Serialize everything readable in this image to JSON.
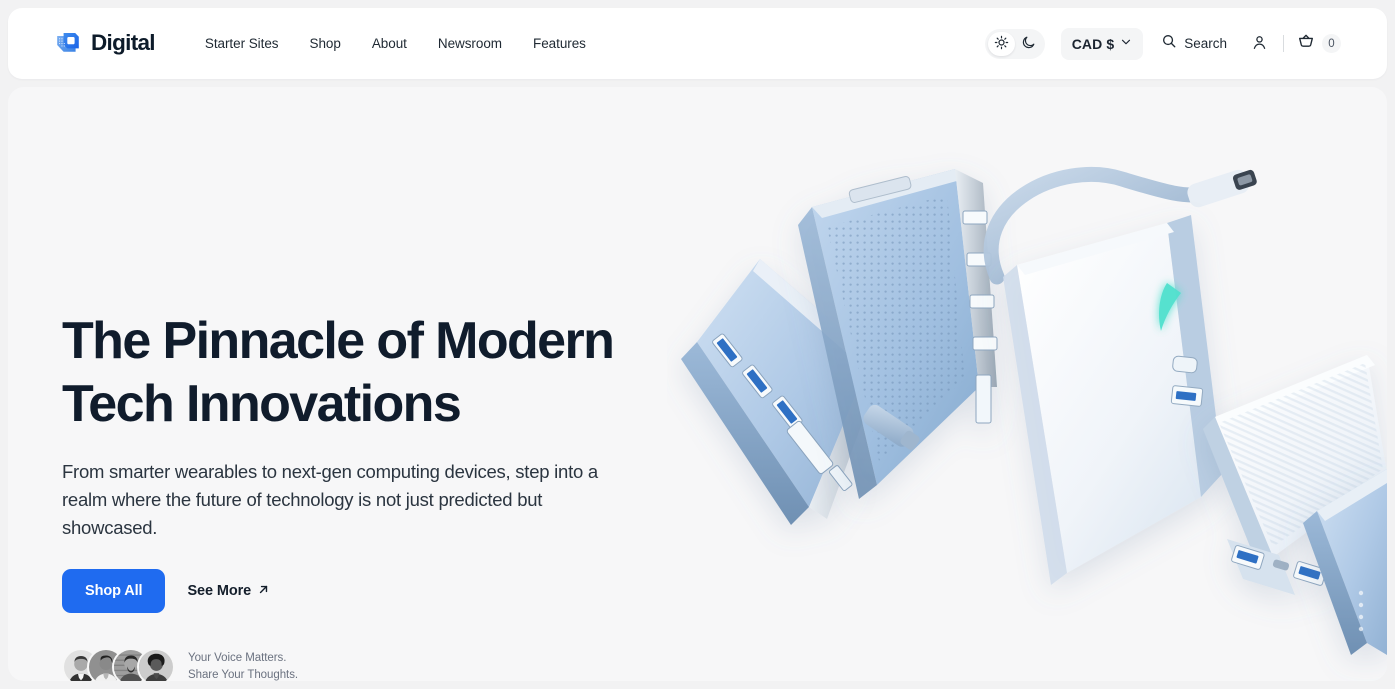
{
  "brand": {
    "name": "Digital",
    "mark_icon": "digital-logo-mark",
    "accent_color": "#1f6bf0",
    "mark_colors": [
      "#4a90e2",
      "#7fb3ef",
      "#1a63e8",
      "#cfe0f7"
    ]
  },
  "nav": {
    "items": [
      {
        "label": "Starter Sites"
      },
      {
        "label": "Shop"
      },
      {
        "label": "About"
      },
      {
        "label": "Newsroom"
      },
      {
        "label": "Features"
      }
    ]
  },
  "header": {
    "theme_toggle": {
      "light_icon": "sun-icon",
      "dark_icon": "moon-icon",
      "active": "light"
    },
    "currency": {
      "label": "CAD $",
      "chevron_icon": "chevron-down-icon"
    },
    "search": {
      "label": "Search",
      "icon": "search-icon"
    },
    "account": {
      "icon": "user-icon"
    },
    "cart": {
      "icon": "basket-icon",
      "count": "0"
    }
  },
  "hero": {
    "title": "The Pinnacle of Modern Tech Innovations",
    "subtitle": "From smarter wearables to next-gen computing devices, step into a realm where the future of technology is not just predicted but showcased.",
    "primary_cta": "Shop All",
    "secondary_cta": "See More",
    "secondary_cta_icon": "arrow-up-right-icon",
    "background_color": "#f7f7f8",
    "title_color": "#101c2c",
    "social_proof": {
      "line1": "Your Voice Matters.",
      "line2": "Share Your Thoughts.",
      "avatar_count": 4,
      "avatars": [
        {
          "name": "avatar-person-1"
        },
        {
          "name": "avatar-person-2"
        },
        {
          "name": "avatar-person-3"
        },
        {
          "name": "avatar-person-4"
        }
      ]
    },
    "visual": {
      "name": "power-bank-usb-hub-product-render",
      "description": "Four floating light-blue power bank / USB-C hub devices with USB-A ports, a coiled USB-C cable and a glowing teal indicator",
      "product_colors": [
        "#b9cfe8",
        "#dce8f5",
        "#8fb3d6",
        "#ffffff",
        "#4fd6c4"
      ]
    }
  }
}
